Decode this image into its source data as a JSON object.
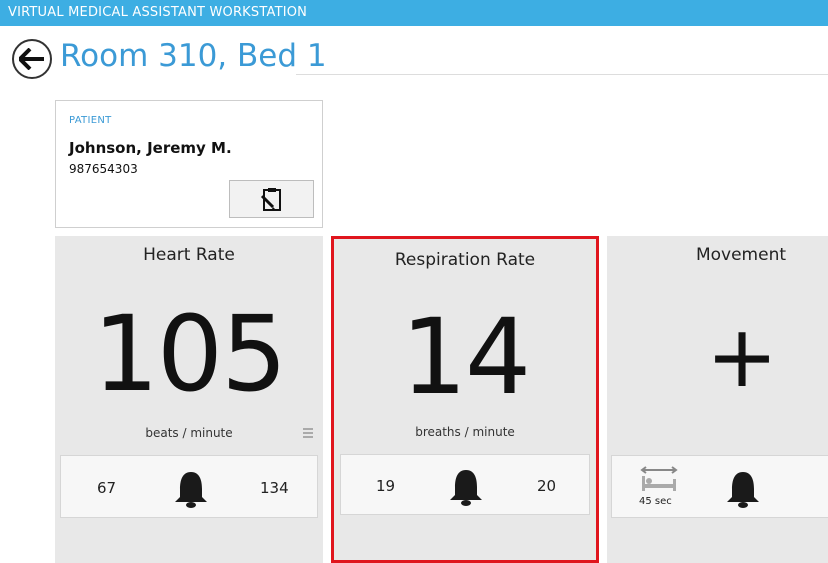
{
  "app": {
    "title": "VIRTUAL MEDICAL ASSISTANT WORKSTATION"
  },
  "page": {
    "title": "Room 310, Bed 1"
  },
  "patient": {
    "label": "PATIENT",
    "name": "Johnson,  Jeremy M.",
    "id": "987654303"
  },
  "panels": {
    "heart_rate": {
      "title": "Heart Rate",
      "value": "105",
      "unit": "beats / minute",
      "low": "67",
      "high": "134"
    },
    "respiration_rate": {
      "title": "Respiration Rate",
      "value": "14",
      "unit": "breaths / minute",
      "low": "19",
      "high": "20",
      "highlight_color": "#e0151d"
    },
    "movement": {
      "title": "Movement",
      "value": "+",
      "interval": "45 sec"
    }
  },
  "colors": {
    "titlebar": "#3daee3",
    "accent": "#3b9ad6",
    "panel_bg": "#e8e8e8"
  }
}
